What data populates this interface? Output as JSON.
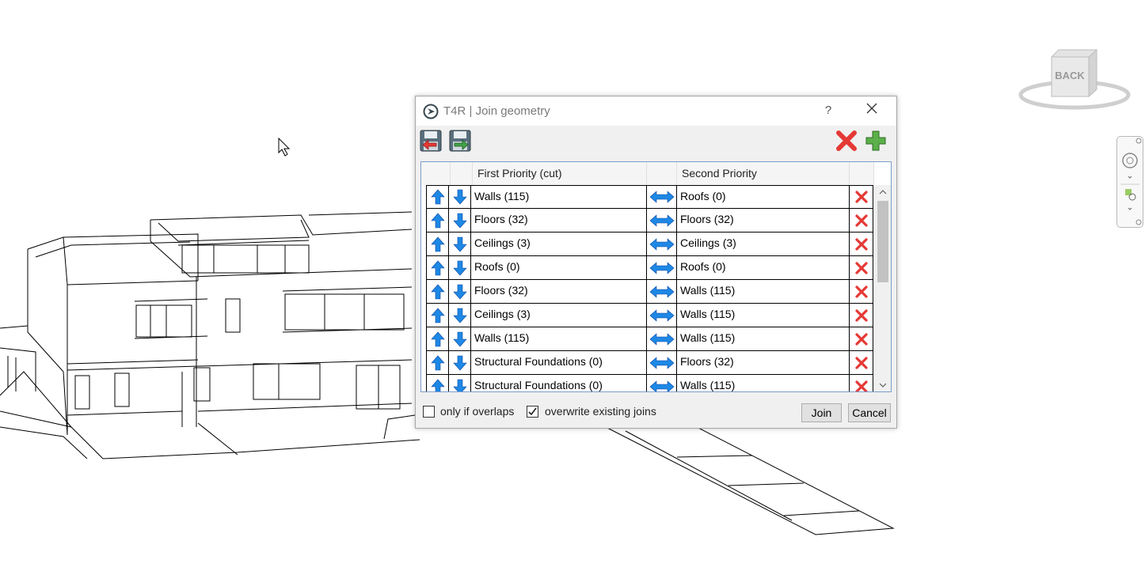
{
  "dialog": {
    "title": "T4R | Join geometry",
    "help_label": "?",
    "columns": {
      "first": "First Priority (cut)",
      "second": "Second Priority"
    },
    "rows": [
      {
        "first": "Walls (115)",
        "second": "Roofs (0)"
      },
      {
        "first": "Floors (32)",
        "second": "Floors (32)"
      },
      {
        "first": "Ceilings (3)",
        "second": "Ceilings (3)"
      },
      {
        "first": "Roofs (0)",
        "second": "Roofs (0)"
      },
      {
        "first": "Floors (32)",
        "second": "Walls (115)"
      },
      {
        "first": "Ceilings (3)",
        "second": "Walls (115)"
      },
      {
        "first": "Walls (115)",
        "second": "Walls (115)"
      },
      {
        "first": "Structural Foundations (0)",
        "second": "Floors (32)"
      },
      {
        "first": "Structural Foundations (0)",
        "second": "Walls (115)"
      }
    ],
    "options": {
      "only_if_overlaps": {
        "label": "only if overlaps",
        "checked": false
      },
      "overwrite_existing": {
        "label": "overwrite existing joins",
        "checked": true
      }
    },
    "join_label": "Join",
    "cancel_label": "Cancel"
  },
  "viewcube": {
    "face_label": "BACK"
  },
  "colors": {
    "arrow_blue": "#1e88e5",
    "delete_red": "#e53935",
    "add_green": "#43a047",
    "grid_border": "#7a9ccc"
  },
  "icons": [
    "load-icon",
    "save-icon",
    "delete-all-icon",
    "add-icon",
    "arrow-up-icon",
    "arrow-down-icon",
    "swap-icon",
    "delete-row-icon"
  ]
}
